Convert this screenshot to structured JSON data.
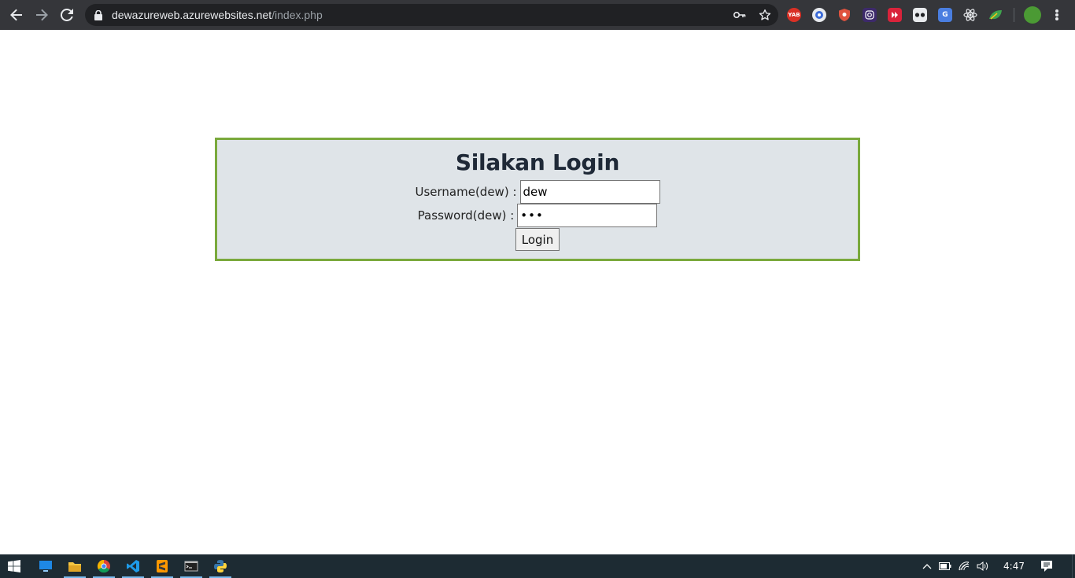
{
  "browser": {
    "url_host": "dewazureweb.azurewebsites.net",
    "url_path": "/index.php",
    "extensions": [
      {
        "name": "yab-extension-icon",
        "label": "YAB",
        "color": "#d93025"
      },
      {
        "name": "circle-extension-icon",
        "label": "",
        "color": "#3b6bd8"
      },
      {
        "name": "shield-extension-icon",
        "label": "",
        "color": "#e0533f"
      },
      {
        "name": "instagram-extension-icon",
        "label": "",
        "color": "#6c5ce7"
      },
      {
        "name": "play-extension-icon",
        "label": "",
        "color": "#d9233b"
      },
      {
        "name": "reader-extension-icon",
        "label": "",
        "color": "#e8eaed"
      },
      {
        "name": "translate-extension-icon",
        "label": "",
        "color": "#4a7ee0"
      },
      {
        "name": "react-extension-icon",
        "label": "",
        "color": "#e8eaed"
      },
      {
        "name": "leaf-extension-icon",
        "label": "",
        "color": "#3fa34d"
      }
    ]
  },
  "login": {
    "title": "Silakan Login",
    "username_label": "Username(dew) :",
    "username_value": "dew",
    "password_label": "Password(dew) :",
    "password_value": "•••",
    "button_label": "Login"
  },
  "taskbar": {
    "time": "4:47",
    "apps": [
      "desktop-icon",
      "file-explorer-icon",
      "chrome-icon",
      "vscode-icon",
      "sublime-icon",
      "terminal-icon",
      "python-icon"
    ]
  },
  "colors": {
    "login_border": "#7aa93c",
    "login_background": "#dfe4e8",
    "toolbar": "#35363a",
    "taskbar": "#1d2b33"
  }
}
